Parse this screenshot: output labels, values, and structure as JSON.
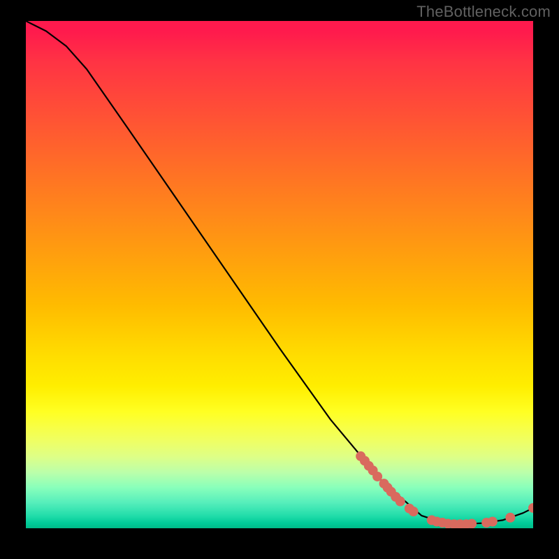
{
  "watermark": "TheBottleneck.com",
  "colors": {
    "dot": "#d96a5e",
    "curve": "#000000",
    "background": "#000000"
  },
  "chart_data": {
    "type": "line",
    "title": "",
    "xlabel": "",
    "ylabel": "",
    "xlim": [
      0,
      100
    ],
    "ylim": [
      0,
      100
    ],
    "grid": false,
    "legend": false,
    "curve": [
      {
        "x": 0,
        "y": 100
      },
      {
        "x": 4,
        "y": 98
      },
      {
        "x": 8,
        "y": 95
      },
      {
        "x": 12,
        "y": 90.5
      },
      {
        "x": 20,
        "y": 79
      },
      {
        "x": 30,
        "y": 64.5
      },
      {
        "x": 40,
        "y": 50
      },
      {
        "x": 50,
        "y": 35.5
      },
      {
        "x": 60,
        "y": 21.5
      },
      {
        "x": 70,
        "y": 9.5
      },
      {
        "x": 78,
        "y": 2.5
      },
      {
        "x": 82,
        "y": 1.2
      },
      {
        "x": 86,
        "y": 0.8
      },
      {
        "x": 90,
        "y": 1.0
      },
      {
        "x": 94,
        "y": 1.6
      },
      {
        "x": 98,
        "y": 3.0
      },
      {
        "x": 100,
        "y": 4.0
      }
    ],
    "series": [
      {
        "name": "highlighted-points",
        "type": "scatter",
        "points": [
          {
            "x": 66.0,
            "y": 14.2,
            "r": 7
          },
          {
            "x": 66.8,
            "y": 13.3,
            "r": 7
          },
          {
            "x": 67.6,
            "y": 12.3,
            "r": 7
          },
          {
            "x": 68.4,
            "y": 11.4,
            "r": 7
          },
          {
            "x": 69.3,
            "y": 10.2,
            "r": 7
          },
          {
            "x": 70.6,
            "y": 8.8,
            "r": 7
          },
          {
            "x": 71.3,
            "y": 8.0,
            "r": 7
          },
          {
            "x": 72.0,
            "y": 7.2,
            "r": 7
          },
          {
            "x": 72.9,
            "y": 6.2,
            "r": 7
          },
          {
            "x": 73.8,
            "y": 5.3,
            "r": 7
          },
          {
            "x": 75.6,
            "y": 3.9,
            "r": 7
          },
          {
            "x": 76.4,
            "y": 3.3,
            "r": 7
          },
          {
            "x": 80.0,
            "y": 1.6,
            "r": 7
          },
          {
            "x": 81.0,
            "y": 1.3,
            "r": 7
          },
          {
            "x": 82.1,
            "y": 1.1,
            "r": 7
          },
          {
            "x": 83.2,
            "y": 0.9,
            "r": 7
          },
          {
            "x": 84.4,
            "y": 0.8,
            "r": 7
          },
          {
            "x": 85.6,
            "y": 0.8,
            "r": 7
          },
          {
            "x": 86.8,
            "y": 0.8,
            "r": 7
          },
          {
            "x": 87.9,
            "y": 0.9,
            "r": 7
          },
          {
            "x": 90.8,
            "y": 1.1,
            "r": 7
          },
          {
            "x": 92.0,
            "y": 1.3,
            "r": 7
          },
          {
            "x": 95.5,
            "y": 2.1,
            "r": 7
          },
          {
            "x": 100.0,
            "y": 4.0,
            "r": 7
          }
        ]
      }
    ]
  }
}
